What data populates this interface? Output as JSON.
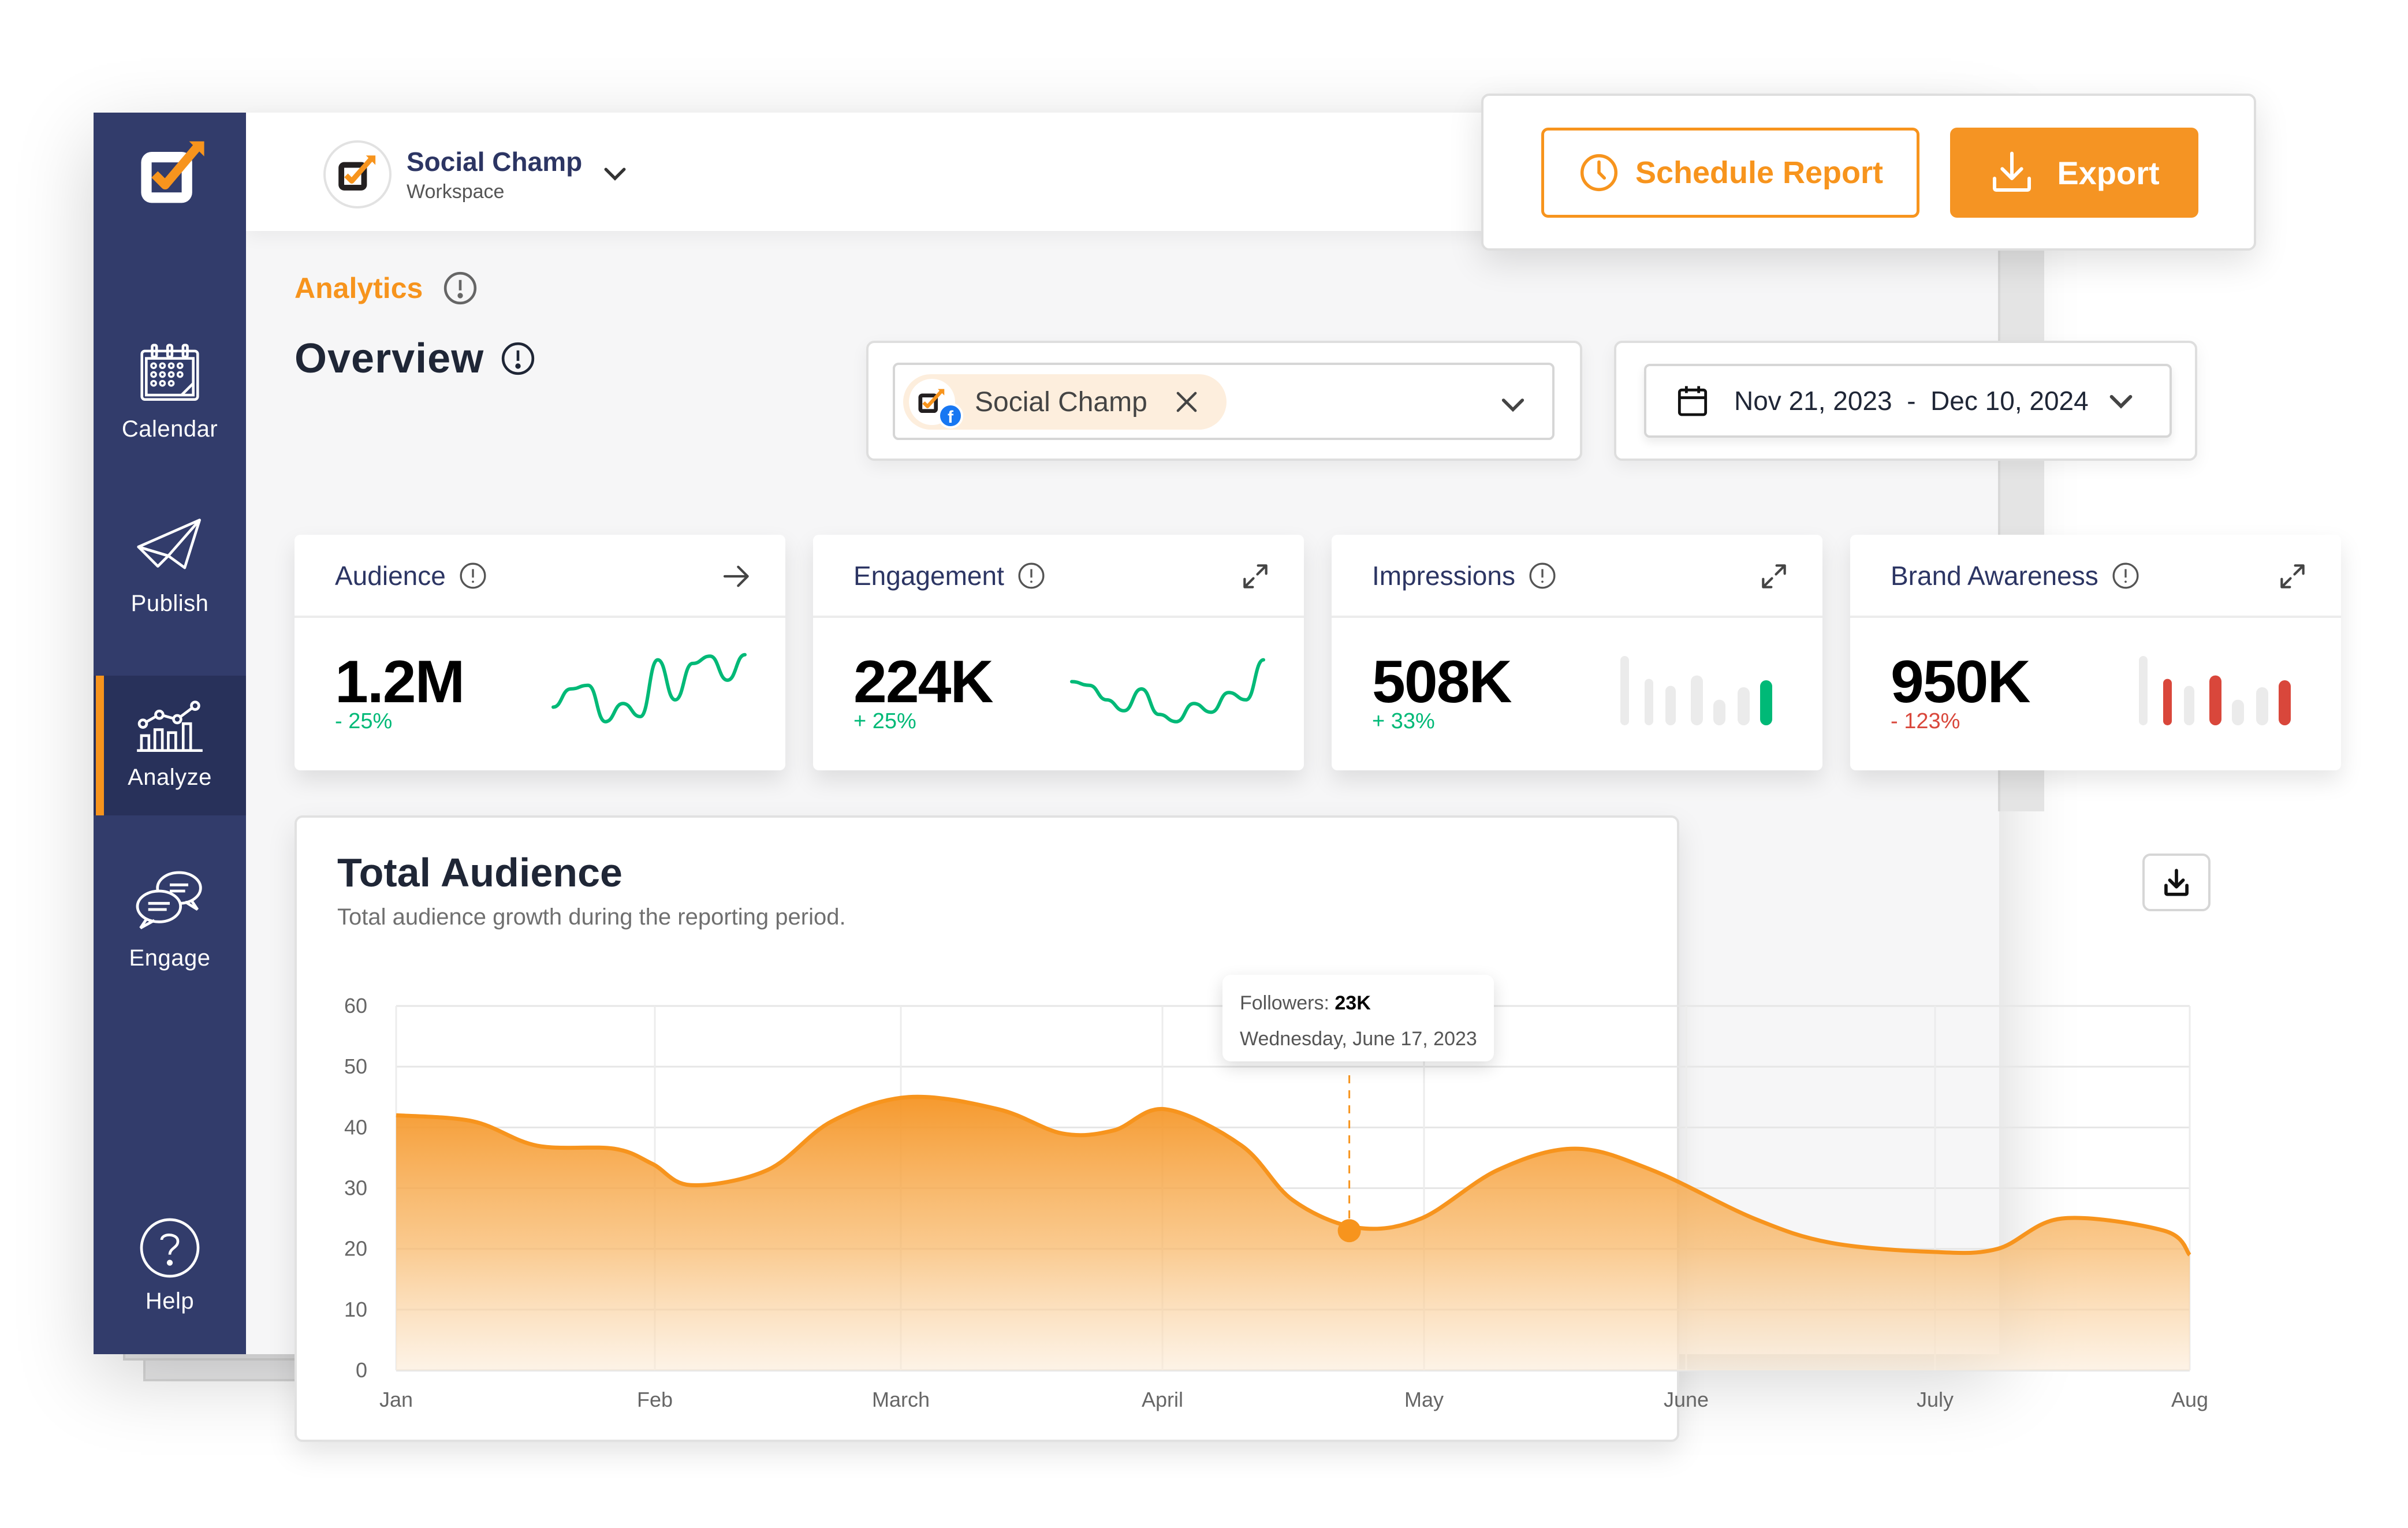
{
  "app": {
    "brand_color": "#f7941d",
    "sidebar_color": "#323c6b",
    "positive_color": "#00b977",
    "negative_color": "#d9473b"
  },
  "sidebar": {
    "logo_icon": "social-champ-logo-icon",
    "items": [
      {
        "label": "Calendar",
        "icon": "calendar-icon",
        "active": false
      },
      {
        "label": "Publish",
        "icon": "paper-plane-icon",
        "active": false
      },
      {
        "label": "Analyze",
        "icon": "analytics-chart-icon",
        "active": true
      },
      {
        "label": "Engage",
        "icon": "chat-bubbles-icon",
        "active": false
      },
      {
        "label": "Help",
        "icon": "help-circle-icon",
        "active": false
      }
    ]
  },
  "header": {
    "workspace_name": "Social Champ",
    "workspace_sub": "Workspace"
  },
  "actions": {
    "schedule_label": "Schedule Report",
    "export_label": "Export"
  },
  "page": {
    "breadcrumb": "Analytics",
    "title": "Overview"
  },
  "filters": {
    "account_chip": "Social Champ",
    "account_network": "facebook",
    "date_range": "Nov 21, 2023  -  Dec 10, 2024"
  },
  "cards": [
    {
      "title": "Audience",
      "value": "1.2M",
      "delta": "- 25%",
      "delta_color": "#00b977",
      "action_icon": "arrow-right-icon",
      "spark_type": "line",
      "spark": [
        0.25,
        0.5,
        0.55,
        0.05,
        0.3,
        0.12,
        0.9,
        0.35,
        0.85,
        0.95,
        0.62,
        0.97
      ]
    },
    {
      "title": "Engagement",
      "value": "224K",
      "delta": "+ 25%",
      "delta_color": "#00b977",
      "action_icon": "expand-icon",
      "spark_type": "line",
      "spark": [
        0.6,
        0.55,
        0.35,
        0.2,
        0.5,
        0.15,
        0.05,
        0.3,
        0.18,
        0.45,
        0.35,
        0.9
      ]
    },
    {
      "title": "Impressions",
      "value": "508K",
      "delta": "+ 33%",
      "delta_color": "#00b977",
      "action_icon": "expand-icon",
      "spark_type": "bars",
      "spark": [
        1.0,
        0.67,
        0.57,
        0.72,
        0.37,
        0.55,
        0.65
      ],
      "highlight": [
        6
      ],
      "highlight_color": "#00b977"
    },
    {
      "title": "Brand Awareness",
      "value": "950K",
      "delta": "- 123%",
      "delta_color": "#d9473b",
      "action_icon": "expand-icon",
      "spark_type": "bars",
      "spark": [
        1.0,
        0.67,
        0.57,
        0.72,
        0.37,
        0.55,
        0.65
      ],
      "highlight": [
        1,
        3,
        6
      ],
      "highlight_color": "#d9473b"
    }
  ],
  "chart": {
    "title": "Total Audience",
    "subtitle": "Total audience growth during the reporting period.",
    "tooltip_label": "Followers: ",
    "tooltip_value": "23K",
    "tooltip_date": "Wednesday, June 17, 2023"
  },
  "chart_data": {
    "type": "area",
    "title": "Total Audience",
    "subtitle": "Total audience growth during the reporting period.",
    "xlabel": "",
    "ylabel": "",
    "categories": [
      "Jan",
      "Feb",
      "March",
      "April",
      "May",
      "June",
      "July",
      "Aug"
    ],
    "ylim": [
      0,
      60
    ],
    "yticks": [
      0,
      10,
      20,
      30,
      40,
      50,
      60
    ],
    "grid": true,
    "series": [
      {
        "name": "Followers",
        "color": "#f7941d",
        "x": [
          0,
          0.3,
          0.55,
          0.85,
          1.0,
          1.15,
          1.45,
          1.7,
          2.0,
          2.35,
          2.6,
          2.8,
          3.0,
          3.3,
          3.5,
          3.75,
          4.0,
          4.3,
          4.6,
          4.9,
          5.3,
          5.6,
          6.0,
          6.25,
          6.5,
          6.9,
          7.0
        ],
        "y": [
          42,
          41,
          37,
          36.5,
          34,
          30.5,
          33,
          41,
          45,
          43,
          39,
          39.5,
          43,
          37,
          28,
          23.5,
          25,
          33,
          36.5,
          33,
          25,
          21,
          19.5,
          20,
          25,
          23,
          19
        ]
      }
    ],
    "highlight_point": {
      "x": 3.72,
      "y": 23,
      "label": "Followers: 23K",
      "date": "Wednesday, June 17, 2023"
    }
  }
}
